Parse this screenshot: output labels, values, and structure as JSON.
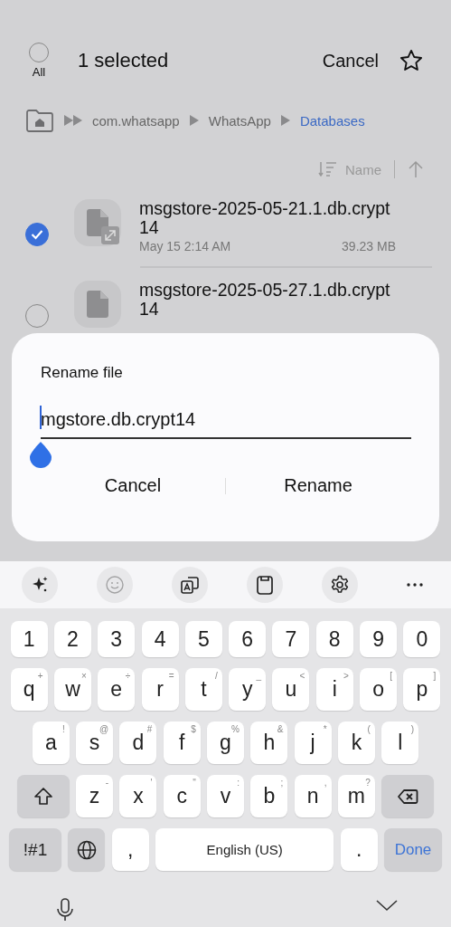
{
  "header": {
    "all_label": "All",
    "all_checked": false,
    "title": "1 selected",
    "cancel": "Cancel"
  },
  "path": [
    {
      "label": "com.whatsapp",
      "selected": false
    },
    {
      "label": "WhatsApp",
      "selected": false
    },
    {
      "label": "Databases",
      "selected": true
    }
  ],
  "sort": {
    "label": "Name"
  },
  "files": [
    {
      "name": "msgstore-2025-05-21.1.db.crypt14",
      "date": "May 15 2:14 AM",
      "size": "39.23 MB",
      "selected": true
    },
    {
      "name": "msgstore-2025-05-27.1.db.crypt14",
      "selected": false
    }
  ],
  "dialog": {
    "title": "Rename file",
    "value": "mgstore.db.crypt14",
    "buttons": [
      "Cancel",
      "Rename"
    ]
  },
  "keyboard": {
    "toolbar": [
      {
        "kind": "sparkle",
        "disabled": false
      },
      {
        "kind": "emoji",
        "disabled": true
      },
      {
        "kind": "translate",
        "disabled": false
      },
      {
        "kind": "clipboard",
        "disabled": false
      },
      {
        "kind": "settings",
        "disabled": false
      },
      {
        "kind": "more",
        "disabled": false
      }
    ],
    "rows": [
      [
        {
          "kind": "char",
          "label": "1"
        },
        {
          "kind": "char",
          "label": "2"
        },
        {
          "kind": "char",
          "label": "3"
        },
        {
          "kind": "char",
          "label": "4"
        },
        {
          "kind": "char",
          "label": "5"
        },
        {
          "kind": "char",
          "label": "6"
        },
        {
          "kind": "char",
          "label": "7"
        },
        {
          "kind": "char",
          "label": "8"
        },
        {
          "kind": "char",
          "label": "9"
        },
        {
          "kind": "char",
          "label": "0"
        }
      ],
      [
        {
          "kind": "char",
          "label": "q",
          "hint": "+"
        },
        {
          "kind": "char",
          "label": "w",
          "hint": "×"
        },
        {
          "kind": "char",
          "label": "e",
          "hint": "÷"
        },
        {
          "kind": "char",
          "label": "r",
          "hint": "="
        },
        {
          "kind": "char",
          "label": "t",
          "hint": "/"
        },
        {
          "kind": "char",
          "label": "y",
          "hint": "_"
        },
        {
          "kind": "char",
          "label": "u",
          "hint": "<"
        },
        {
          "kind": "char",
          "label": "i",
          "hint": ">"
        },
        {
          "kind": "char",
          "label": "o",
          "hint": "["
        },
        {
          "kind": "char",
          "label": "p",
          "hint": "]"
        }
      ],
      [
        {
          "kind": "char",
          "label": "a",
          "hint": "!"
        },
        {
          "kind": "char",
          "label": "s",
          "hint": "@"
        },
        {
          "kind": "char",
          "label": "d",
          "hint": "#"
        },
        {
          "kind": "char",
          "label": "f",
          "hint": "$"
        },
        {
          "kind": "char",
          "label": "g",
          "hint": "%"
        },
        {
          "kind": "char",
          "label": "h",
          "hint": "&"
        },
        {
          "kind": "char",
          "label": "j",
          "hint": "*"
        },
        {
          "kind": "char",
          "label": "k",
          "hint": "("
        },
        {
          "kind": "char",
          "label": "l",
          "hint": ")"
        }
      ],
      [
        {
          "kind": "shift"
        },
        {
          "kind": "char",
          "label": "z",
          "hint": "-"
        },
        {
          "kind": "char",
          "label": "x",
          "hint": "'"
        },
        {
          "kind": "char",
          "label": "c",
          "hint": "\""
        },
        {
          "kind": "char",
          "label": "v",
          "hint": ":"
        },
        {
          "kind": "char",
          "label": "b",
          "hint": ";"
        },
        {
          "kind": "char",
          "label": "n",
          "hint": ","
        },
        {
          "kind": "char",
          "label": "m",
          "hint": "?"
        },
        {
          "kind": "backspace"
        }
      ]
    ],
    "bottom_row": [
      {
        "kind": "symbols",
        "label": "!#1"
      },
      {
        "kind": "globe"
      },
      {
        "kind": "char",
        "label": ","
      },
      {
        "kind": "space",
        "label": "English (US)"
      },
      {
        "kind": "char",
        "label": "."
      },
      {
        "kind": "done",
        "label": "Done"
      }
    ]
  }
}
